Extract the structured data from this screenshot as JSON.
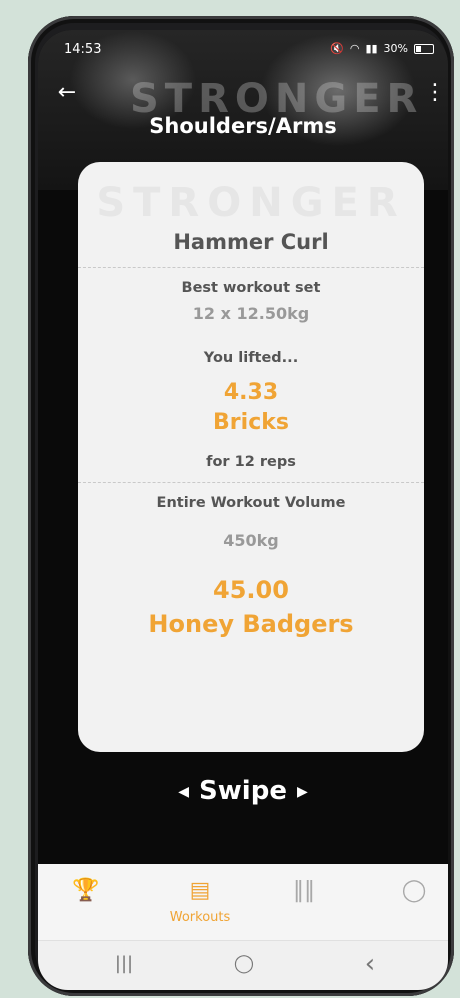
{
  "status": {
    "time": "14:53",
    "battery": "30%",
    "icons": [
      "mute-icon",
      "wifi-icon",
      "signal-icon",
      "battery-icon"
    ]
  },
  "header": {
    "brand": "STRONGER",
    "title": "Shoulders/Arms",
    "back": "←",
    "menu": "⋮"
  },
  "card": {
    "brand": "STRONGER",
    "exercise": "Hammer Curl",
    "best_set_label": "Best workout set",
    "best_set_value": "12 x 12.50kg",
    "lifted_label": "You lifted...",
    "lifted_amount": "4.33",
    "lifted_unit": "Bricks",
    "reps_text": "for 12 reps",
    "volume_label": "Entire Workout Volume",
    "volume_value": "450kg",
    "volume_amount": "45.00",
    "volume_unit": "Honey Badgers"
  },
  "swipe": {
    "label": "Swipe",
    "left": "◀",
    "right": "▶"
  },
  "nav": {
    "items": [
      {
        "name": "trophy-icon",
        "label": ""
      },
      {
        "name": "workouts-icon",
        "label": "Workouts"
      },
      {
        "name": "dumbbell-icon",
        "label": ""
      },
      {
        "name": "profile-icon",
        "label": ""
      }
    ]
  },
  "sysnav": {
    "recents": "|||",
    "home": "◯",
    "back": "‹"
  },
  "colors": {
    "accent": "#f0a435",
    "card": "#f2f2f2",
    "text": "#555555",
    "muted": "#999999"
  }
}
